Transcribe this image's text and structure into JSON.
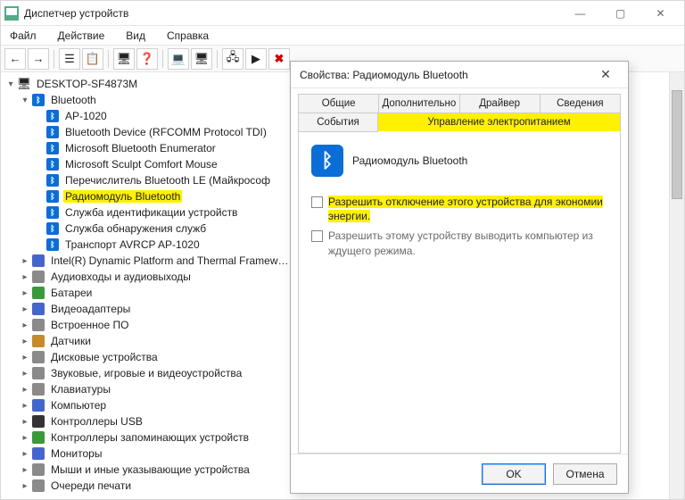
{
  "window": {
    "title": "Диспетчер устройств"
  },
  "menubar": {
    "file": "Файл",
    "action": "Действие",
    "view": "Вид",
    "help": "Справка"
  },
  "toolbar": {
    "back": "←",
    "forward": "→",
    "btns": [
      "☰",
      "📋",
      "🖥",
      "❓",
      "💻",
      "🖥",
      "🖧",
      "▶",
      "✖"
    ]
  },
  "tree": {
    "root": "DESKTOP-SF4873M",
    "bluetooth": {
      "label": "Bluetooth",
      "children": [
        "AP-1020",
        "Bluetooth Device (RFCOMM Protocol TDI)",
        "Microsoft Bluetooth Enumerator",
        "Microsoft Sculpt Comfort Mouse",
        "Перечислитель Bluetooth LE (Майкрософ",
        "Радиомодуль Bluetooth",
        "Служба идентификации устройств",
        "Служба обнаружения служб",
        "Транспорт AVRCP AP-1020"
      ],
      "highlight_index": 5
    },
    "categories": [
      "Intel(R) Dynamic Platform and Thermal Framew…",
      "Аудиовходы и аудиовыходы",
      "Батареи",
      "Видеоадаптеры",
      "Встроенное ПО",
      "Датчики",
      "Дисковые устройства",
      "Звуковые, игровые и видеоустройства",
      "Клавиатуры",
      "Компьютер",
      "Контроллеры USB",
      "Контроллеры запоминающих устройств",
      "Мониторы",
      "Мыши и иные указывающие устройства",
      "Очереди печати"
    ]
  },
  "dialog": {
    "title": "Свойства: Радиомодуль Bluetooth",
    "tabs_row1": [
      "Общие",
      "Дополнительно",
      "Драйвер",
      "Сведения"
    ],
    "tabs_row2": [
      "События",
      "Управление электропитанием"
    ],
    "active_tab": "Управление электропитанием",
    "device_name": "Радиомодуль Bluetooth",
    "opt1": "Разрешить отключение этого устройства для экономии энергии.",
    "opt2": "Разрешить этому устройству выводить компьютер из ждущего режима.",
    "ok": "OK",
    "cancel": "Отмена"
  }
}
